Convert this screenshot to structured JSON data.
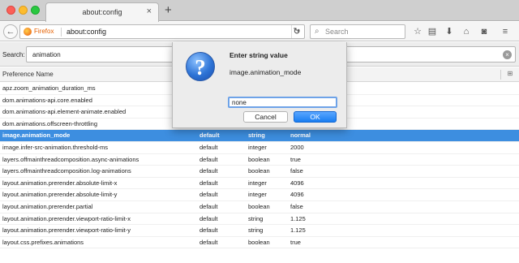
{
  "tab": {
    "title": "about:config"
  },
  "navbar": {
    "identity": "Firefox",
    "url": "about:config",
    "search_placeholder": "Search",
    "icons": [
      "back-icon",
      "reload-icon",
      "bookmark-star-icon",
      "reading-list-icon",
      "download-icon",
      "home-icon",
      "pocket-icon",
      "menu-icon"
    ]
  },
  "filter": {
    "label": "Search:",
    "value": "animation"
  },
  "columns": {
    "name": "Preference Name"
  },
  "rows": [
    {
      "name": "apz.zoom_animation_duration_ms",
      "status": "",
      "type": "",
      "value": ""
    },
    {
      "name": "dom.animations-api.core.enabled",
      "status": "",
      "type": "",
      "value": ""
    },
    {
      "name": "dom.animations-api.element-animate.enabled",
      "status": "",
      "type": "",
      "value": ""
    },
    {
      "name": "dom.animations.offscreen-throttling",
      "status": "",
      "type": "",
      "value": ""
    },
    {
      "name": "image.animation_mode",
      "status": "default",
      "type": "string",
      "value": "normal",
      "selected": true
    },
    {
      "name": "image.infer-src-animation.threshold-ms",
      "status": "default",
      "type": "integer",
      "value": "2000"
    },
    {
      "name": "layers.offmainthreadcomposition.async-animations",
      "status": "default",
      "type": "boolean",
      "value": "true"
    },
    {
      "name": "layers.offmainthreadcomposition.log-animations",
      "status": "default",
      "type": "boolean",
      "value": "false"
    },
    {
      "name": "layout.animation.prerender.absolute-limit-x",
      "status": "default",
      "type": "integer",
      "value": "4096"
    },
    {
      "name": "layout.animation.prerender.absolute-limit-y",
      "status": "default",
      "type": "integer",
      "value": "4096"
    },
    {
      "name": "layout.animation.prerender.partial",
      "status": "default",
      "type": "boolean",
      "value": "false"
    },
    {
      "name": "layout.animation.prerender.viewport-ratio-limit-x",
      "status": "default",
      "type": "string",
      "value": "1.125"
    },
    {
      "name": "layout.animation.prerender.viewport-ratio-limit-y",
      "status": "default",
      "type": "string",
      "value": "1.125"
    },
    {
      "name": "layout.css.prefixes.animations",
      "status": "default",
      "type": "boolean",
      "value": "true"
    }
  ],
  "dialog": {
    "title": "Enter string value",
    "message": "image.animation_mode",
    "input_value": "none",
    "cancel_label": "Cancel",
    "ok_label": "OK"
  },
  "colors": {
    "selection": "#3d8ee0",
    "ok_button": "#197ef1",
    "firefox_orange": "#e66000"
  }
}
